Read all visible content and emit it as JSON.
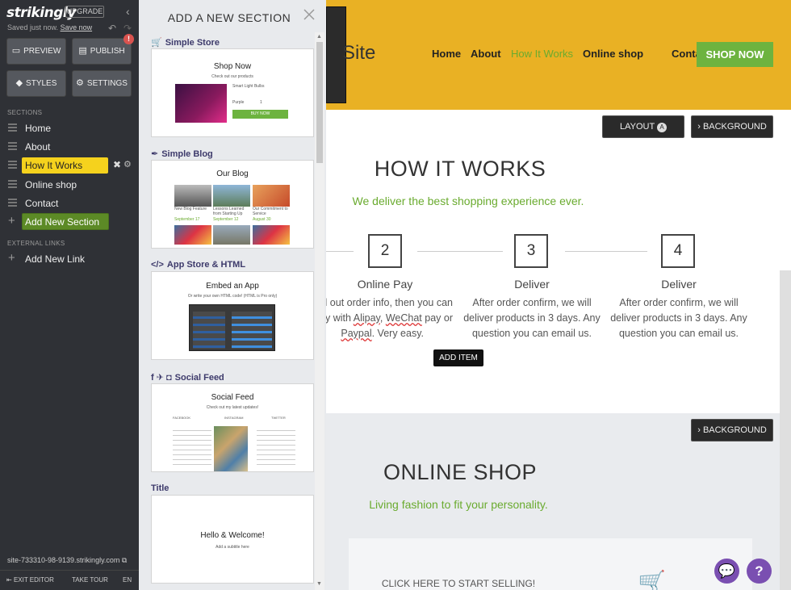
{
  "sidebar": {
    "logo": "strikingly",
    "upgrade": "UPGRADE",
    "saved_text": "Saved just now.",
    "save_now": "Save now",
    "buttons": {
      "preview": "PREVIEW",
      "publish": "PUBLISH",
      "styles": "STYLES",
      "settings": "SETTINGS"
    },
    "publish_badge": "!",
    "sections_heading": "SECTIONS",
    "items": [
      {
        "label": "Home"
      },
      {
        "label": "About"
      },
      {
        "label": "How It Works"
      },
      {
        "label": "Online shop"
      },
      {
        "label": "Contact"
      }
    ],
    "add_section": "Add New Section",
    "external_heading": "EXTERNAL LINKS",
    "add_link": "Add New Link",
    "site_url": "site-733310-98-9139.strikingly.com",
    "footer": {
      "exit": "EXIT EDITOR",
      "tour": "TAKE TOUR",
      "lang": "EN"
    }
  },
  "panel": {
    "title": "ADD A NEW SECTION",
    "sections": [
      {
        "name": "Simple Store",
        "card_title": "Shop Now",
        "card_sub": "Check out our products",
        "product": "Smart Light Bulbs",
        "variant": "Purple",
        "qty": "1",
        "buy": "BUY NOW"
      },
      {
        "name": "Simple Blog",
        "card_title": "Our Blog",
        "posts": [
          {
            "title": "New Blog Feature",
            "date": "September 17"
          },
          {
            "title": "Lessons Learned from Starting Up",
            "date": "September 12"
          },
          {
            "title": "Our Commitment to Service",
            "date": "August 30"
          }
        ]
      },
      {
        "name": "App Store & HTML",
        "card_title": "Embed an App",
        "card_sub": "Or write your own HTML code! (HTML is Pro only)"
      },
      {
        "name": "Social Feed",
        "card_title": "Social Feed",
        "card_sub": "Check out my latest updates!",
        "tabs": [
          "FACEBOOK",
          "INSTAGRAM",
          "TWITTER"
        ]
      },
      {
        "name": "Title",
        "card_title": "Hello & Welcome!",
        "card_sub": "Add a subtitle here"
      }
    ]
  },
  "site": {
    "site_name": "Site",
    "nav": [
      "Home",
      "About",
      "How It Works",
      "Online shop",
      "Contact"
    ],
    "cta": "SHOP NOW",
    "layout_btn": "LAYOUT",
    "layout_badge": "A",
    "background_btn": "› BACKGROUND",
    "how_title": "HOW IT WORKS",
    "how_sub": "We deliver the best shopping experience ever.",
    "steps": [
      {
        "num": "2",
        "title": "Online Pay",
        "d1": "ll out order info, then you can",
        "d2a": "ay with ",
        "alipay": "Alipay",
        "comma": ", ",
        "wechat": "WeChat",
        "d2b": " pay or",
        "paypal": "Paypal",
        "d3": ". Very easy."
      },
      {
        "num": "3",
        "title": "Deliver",
        "d1": "After order confirm, we will",
        "d2": "deliver products in 3 days. Any",
        "d3": "question you can email us."
      },
      {
        "num": "4",
        "title": "Deliver",
        "d1": "After order confirm, we will",
        "d2": "deliver products in 3 days. Any",
        "d3": "question you can email us."
      }
    ],
    "add_item": "ADD ITEM",
    "shop_title": "ONLINE SHOP",
    "shop_sub": "Living fashion to fit your personality.",
    "shop_cta": "CLICK HERE TO START SELLING!"
  }
}
